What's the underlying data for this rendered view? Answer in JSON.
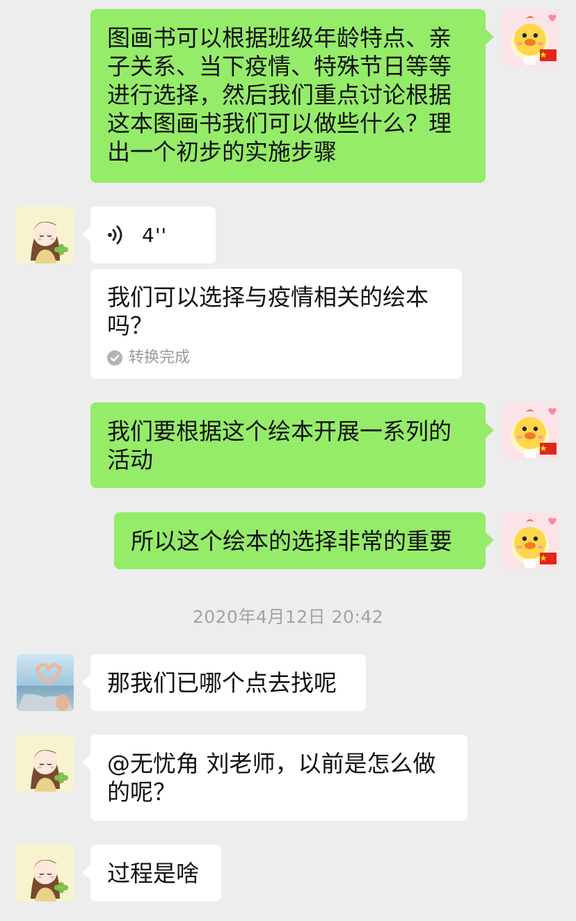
{
  "messages": [
    {
      "side": "out",
      "text": "图画书可以根据班级年龄特点、亲子关系、当下疫情、特殊节日等等进行选择，然后我们重点讨论根据这本图画书我们可以做些什么？理出一个初步的实施步骤"
    },
    {
      "side": "in",
      "type": "voice",
      "duration": "4''",
      "transcript": "我们可以选择与疫情相关的绘本吗？",
      "status": "转换完成"
    },
    {
      "side": "out",
      "text": "我们要根据这个绘本开展一系列的活动"
    },
    {
      "side": "out",
      "text": "所以这个绘本的选择非常的重要"
    },
    {
      "side": "in",
      "text": "那我们已哪个点去找呢"
    },
    {
      "side": "in",
      "text": "@无忧角 刘老师，以前是怎么做的呢？"
    },
    {
      "side": "in",
      "text": "过程是啥"
    }
  ],
  "timestamp": "2020年4月12日 20:42",
  "icons": {
    "voice": "voice-wave-icon",
    "check": "check-circle-icon",
    "self_avatar": "chick-with-flag-avatar",
    "girl_avatar": "girl-with-clover-avatar",
    "hands_avatar": "heart-hands-beach-avatar"
  },
  "colors": {
    "background": "#ededed",
    "outgoing_bubble": "#95ec69",
    "incoming_bubble": "#ffffff",
    "timestamp_text": "#a3a3a3"
  }
}
